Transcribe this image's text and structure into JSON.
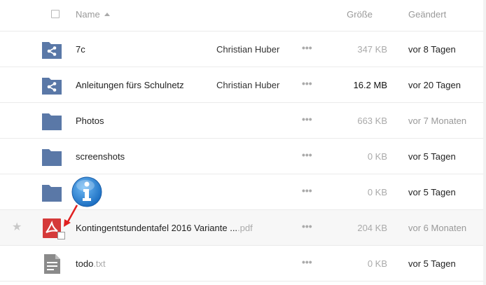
{
  "header": {
    "name_label": "Name",
    "size_label": "Größe",
    "modified_label": "Geändert"
  },
  "rows": [
    {
      "name": "7c",
      "ext": "",
      "owner": "Christian Huber",
      "actions": "•••",
      "size": "347 KB",
      "modified": "vor 8 Tagen",
      "icon": "shared-folder-icon"
    },
    {
      "name": "Anleitungen fürs Schulnetz",
      "ext": "",
      "owner": "Christian Huber",
      "actions": "•••",
      "size": "16.2 MB",
      "modified": "vor 20 Tagen",
      "icon": "shared-folder-icon"
    },
    {
      "name": "Photos",
      "ext": "",
      "owner": "",
      "actions": "•••",
      "size": "663 KB",
      "modified": "vor 7 Monaten",
      "icon": "folder-icon"
    },
    {
      "name": "screenshots",
      "ext": "",
      "owner": "",
      "actions": "•••",
      "size": "0 KB",
      "modified": "vor 5 Tagen",
      "icon": "folder-icon"
    },
    {
      "name": "",
      "ext": "",
      "owner": "",
      "actions": "•••",
      "size": "0 KB",
      "modified": "vor 5 Tagen",
      "icon": "folder-icon"
    },
    {
      "name": "Kontingentstundentafel 2016 Variante ...",
      "ext": ".pdf",
      "owner": "",
      "actions": "•••",
      "size": "204 KB",
      "modified": "vor 6 Monaten",
      "icon": "pdf-file-icon",
      "star": "★"
    },
    {
      "name": "todo",
      "ext": ".txt",
      "owner": "",
      "actions": "•••",
      "size": "0 KB",
      "modified": "vor 5 Tagen",
      "icon": "text-file-icon"
    }
  ],
  "colors": {
    "folder": "#5a78a7",
    "pdf": "#d53a3a",
    "text_file": "#8a8a8a",
    "info_badge": "#2a86d8",
    "arrow": "#e02020"
  }
}
